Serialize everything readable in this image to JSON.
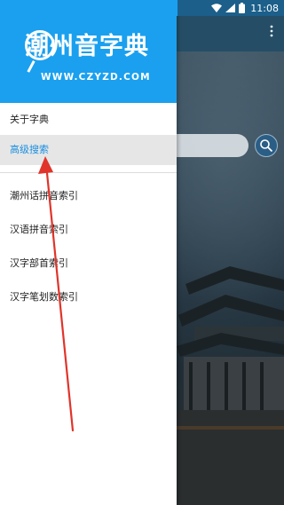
{
  "status_bar": {
    "time": "11:08",
    "icons": [
      "wifi-icon",
      "signal-icon",
      "battery-icon"
    ]
  },
  "drawer": {
    "logo_title": "潮州音字典",
    "logo_url": "WWW.CZYZD.COM",
    "menu": {
      "items": [
        {
          "label": "关于字典"
        },
        {
          "label": "高级搜索"
        }
      ],
      "index_items": [
        {
          "label": "潮州话拼音索引"
        },
        {
          "label": "汉语拼音索引"
        },
        {
          "label": "汉字部首索引"
        },
        {
          "label": "汉字笔划数索引"
        }
      ]
    }
  },
  "background": {
    "overflow_icon": "more-vert-icon",
    "search_icon": "search-icon"
  },
  "colors": {
    "header_blue": "#1aa0ef",
    "active_text": "#1a8fe0",
    "annotation_red": "#e0342a"
  }
}
